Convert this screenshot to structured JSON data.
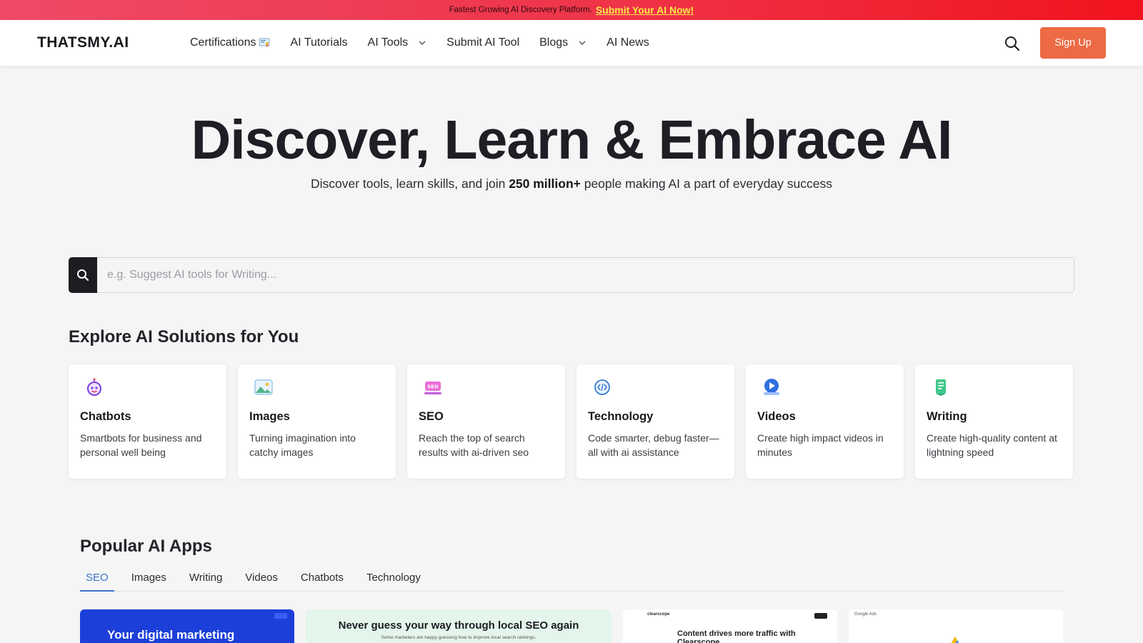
{
  "promo": {
    "text": "Fastest Growing AI Discovery Platform.",
    "link": "Submit Your AI Now!"
  },
  "header": {
    "logo": "THATSMY.AI",
    "nav": [
      {
        "label": "Certifications",
        "icon": "certificate-icon"
      },
      {
        "label": "AI Tutorials"
      },
      {
        "label": "AI Tools",
        "icon": "chevron-down-icon"
      },
      {
        "label": "Submit AI Tool"
      },
      {
        "label": "Blogs",
        "icon": "chevron-down-icon"
      },
      {
        "label": "AI News"
      }
    ],
    "signup_label": "Sign Up"
  },
  "hero": {
    "title": "Discover, Learn & Embrace AI",
    "sub_before": "Discover tools, learn skills, and join ",
    "sub_bold": "250 million+",
    "sub_after": " people making AI a part of everyday success"
  },
  "search": {
    "placeholder": "e.g. Suggest AI tools for Writing..."
  },
  "explore": {
    "title": "Explore AI Solutions for You",
    "cards": [
      {
        "title": "Chatbots",
        "desc": "Smartbots for business and personal well being",
        "icon": "chatbot-icon"
      },
      {
        "title": "Images",
        "desc": "Turning imagination into catchy images",
        "icon": "image-icon"
      },
      {
        "title": "SEO",
        "desc": "Reach the top of search results with ai-driven seo",
        "icon": "seo-icon"
      },
      {
        "title": "Technology",
        "desc": "Code smarter, debug faster—all with ai assistance",
        "icon": "code-icon"
      },
      {
        "title": "Videos",
        "desc": "Create high impact videos in minutes",
        "icon": "video-icon"
      },
      {
        "title": "Writing",
        "desc": "Create high-quality content at lightning speed",
        "icon": "writing-icon"
      }
    ]
  },
  "popular": {
    "title": "Popular AI Apps",
    "tabs": [
      "SEO",
      "Images",
      "Writing",
      "Videos",
      "Chatbots",
      "Technology"
    ],
    "active_tab": "SEO",
    "apps": [
      {
        "headline": "Your digital marketing"
      },
      {
        "headline": "Never guess your way through local SEO again",
        "sub": "Some marketers are happy guessing how to improve local search rankings."
      },
      {
        "brand": "clearscope",
        "headline": "Content drives more traffic with Clearscope"
      },
      {
        "brand": "Google Ads"
      }
    ]
  },
  "colors": {
    "accent": "#ec6a44",
    "active_tab": "#3b73c7",
    "promo_link": "#ffe94a"
  }
}
